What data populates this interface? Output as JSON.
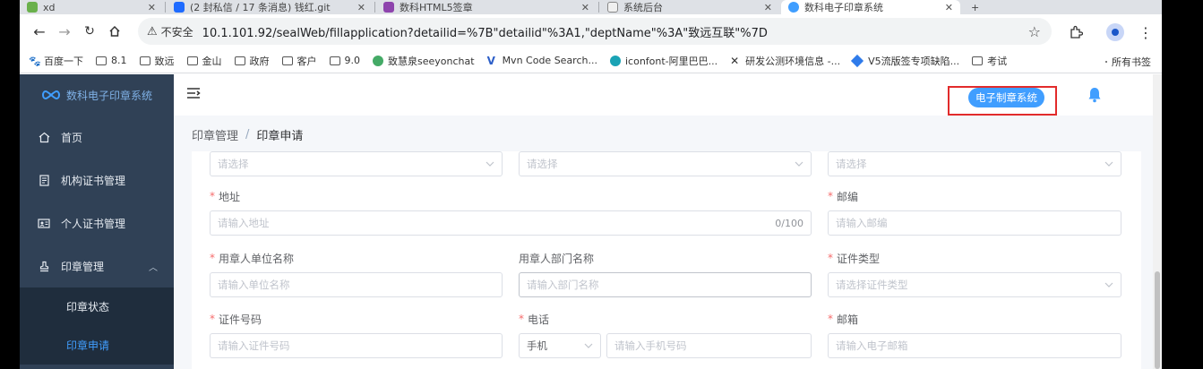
{
  "browser": {
    "tabs": [
      {
        "title": "xd",
        "active": false
      },
      {
        "title": "(2 封私信 / 17 条消息) 钱红.git",
        "active": false
      },
      {
        "title": "数科HTML5签章",
        "active": false
      },
      {
        "title": "系统后台",
        "active": false
      },
      {
        "title": "数科电子印章系统",
        "active": true
      },
      {
        "title": "+",
        "active": false
      }
    ],
    "insecure_label": "不安全",
    "url": "10.1.101.92/sealWeb/fillapplication?detailid=%7B\"detailid\"%3A1,\"deptName\"%3A\"致远互联\"%7D",
    "bookmarks": [
      {
        "label": "百度一下",
        "icon": "paw-icon"
      },
      {
        "label": "8.1",
        "icon": "folder-icon"
      },
      {
        "label": "致远",
        "icon": "folder-icon"
      },
      {
        "label": "金山",
        "icon": "folder-icon"
      },
      {
        "label": "政府",
        "icon": "folder-icon"
      },
      {
        "label": "客户",
        "icon": "folder-icon"
      },
      {
        "label": "9.0",
        "icon": "folder-icon"
      },
      {
        "label": "致慧泉seeyonchat",
        "icon": "seeyon-icon"
      },
      {
        "label": "Mvn Code Search...",
        "icon": "mvn-icon"
      },
      {
        "label": "iconfont-阿里巴巴...",
        "icon": "iconfont-icon"
      },
      {
        "label": "研发公测环境信息 -...",
        "icon": "x-icon"
      },
      {
        "label": "V5流版签专项缺陷...",
        "icon": "diamond-icon"
      },
      {
        "label": "考试",
        "icon": "folder-icon"
      }
    ],
    "all_bookmarks": "所有书签"
  },
  "sidebar": {
    "logo_text": "数科电子印章系统",
    "items": [
      {
        "label": "首页",
        "icon": "home-icon"
      },
      {
        "label": "机构证书管理",
        "icon": "document-icon"
      },
      {
        "label": "个人证书管理",
        "icon": "idcard-icon"
      },
      {
        "label": "印章管理",
        "icon": "stamp-icon",
        "expanded": true
      }
    ],
    "subitems": [
      {
        "label": "印章状态",
        "active": false
      },
      {
        "label": "印章申请",
        "active": true
      }
    ]
  },
  "header": {
    "system_button": "电子制章系统"
  },
  "breadcrumb": {
    "parent": "印章管理",
    "separator": "/",
    "current": "印章申请"
  },
  "form": {
    "row0": [
      {
        "placeholder": "请选择"
      },
      {
        "placeholder": "请选择"
      },
      {
        "placeholder": "请选择"
      }
    ],
    "address": {
      "label": "地址",
      "required": true,
      "placeholder": "请输入地址",
      "count": "0/100"
    },
    "postcode": {
      "label": "邮编",
      "required": true,
      "placeholder": "请输入邮编"
    },
    "org_name": {
      "label": "用章人单位名称",
      "required": true,
      "placeholder": "请输入单位名称"
    },
    "dept_name": {
      "label": "用章人部门名称",
      "required": false,
      "placeholder": "请输入部门名称"
    },
    "cert_type": {
      "label": "证件类型",
      "required": true,
      "placeholder": "请选择证件类型"
    },
    "cert_no": {
      "label": "证件号码",
      "required": true,
      "placeholder": "请输入证件号码"
    },
    "phone": {
      "label": "电话",
      "required": true,
      "type_value": "手机",
      "placeholder": "请输入手机号码"
    },
    "email": {
      "label": "邮箱",
      "required": true,
      "placeholder": "请输入电子邮箱"
    }
  },
  "colors": {
    "sidebar_bg": "#304156",
    "accent": "#409eff",
    "required": "#f56c6c",
    "highlight_box": "#e22b2b"
  }
}
